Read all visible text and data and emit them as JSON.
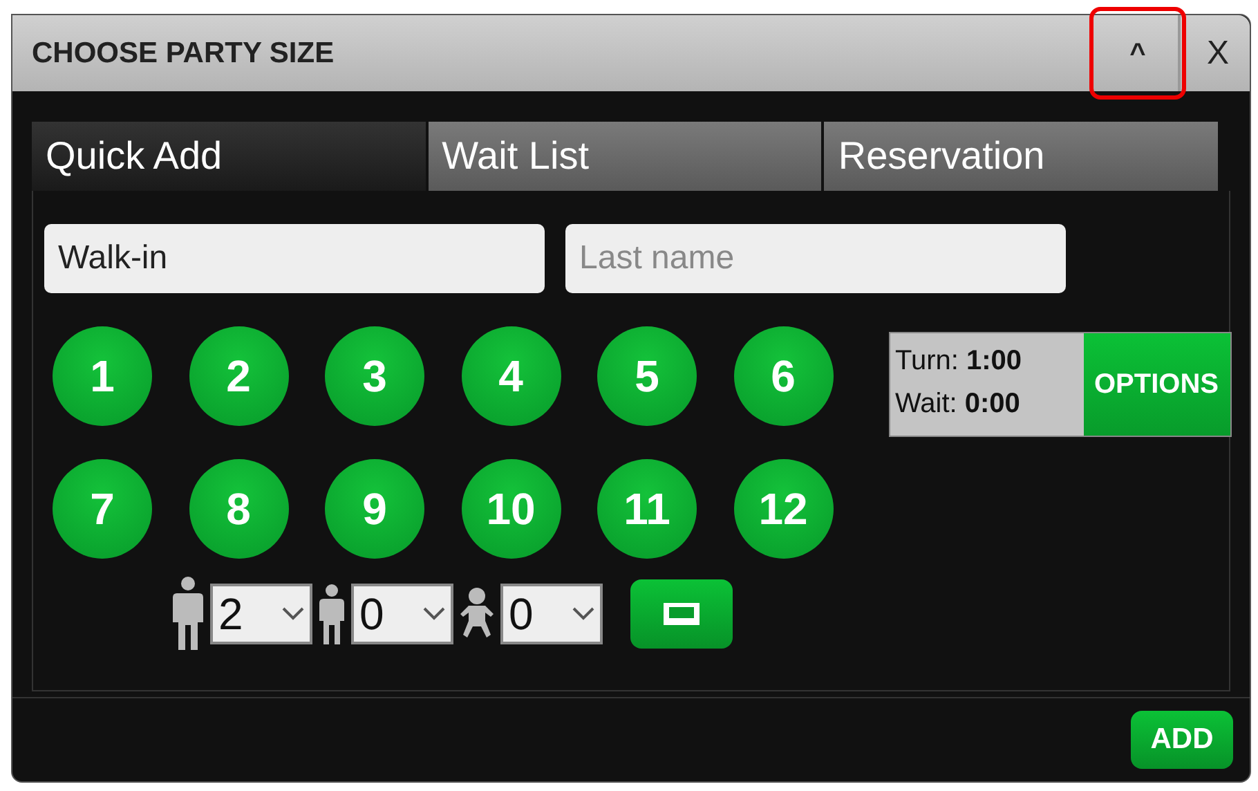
{
  "window": {
    "title": "CHOOSE PARTY SIZE",
    "minimize_button": {
      "label": "^",
      "highlighted": true
    },
    "close_button": {
      "label": "X"
    }
  },
  "tabs": [
    {
      "label": "Quick Add",
      "selected": true
    },
    {
      "label": "Wait List",
      "selected": false
    },
    {
      "label": "Reservation",
      "selected": false
    }
  ],
  "first_name": {
    "value": "Walk-in"
  },
  "last_name": {
    "placeholder": "Last name"
  },
  "party_sizes": [
    "1",
    "2",
    "3",
    "4",
    "5",
    "6",
    "7",
    "8",
    "9",
    "10",
    "11",
    "12"
  ],
  "guest_counts": [
    {
      "kind": "adult",
      "value": "2"
    },
    {
      "kind": "child",
      "value": "0"
    },
    {
      "kind": "infant",
      "value": "0"
    }
  ],
  "info": {
    "turn_label": "Turn:",
    "turn_value": "1:00",
    "wait_label": "Wait:",
    "wait_value": "0:00"
  },
  "options_button": "OPTIONS",
  "add_button": "ADD"
}
